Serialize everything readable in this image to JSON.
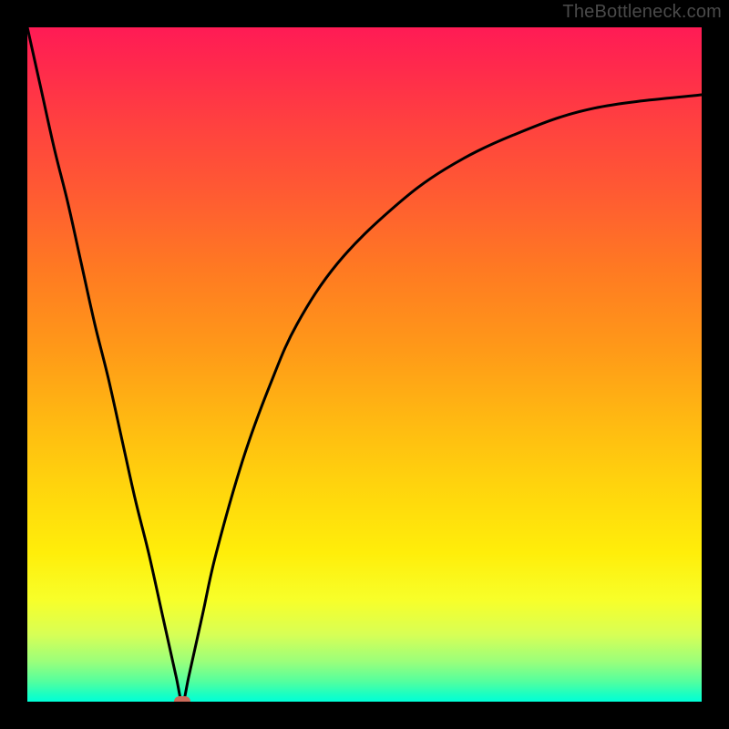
{
  "watermark": "TheBottleneck.com",
  "colors": {
    "frame": "#000000",
    "curve": "#000000",
    "marker": "#cc6a5a"
  },
  "chart_data": {
    "type": "line",
    "title": "",
    "xlabel": "",
    "ylabel": "",
    "x": [
      0,
      2,
      4,
      6,
      8,
      10,
      12,
      14,
      16,
      18,
      20,
      22,
      23,
      24,
      26,
      28,
      32,
      36,
      40,
      46,
      54,
      62,
      72,
      84,
      100
    ],
    "values": [
      100,
      91,
      82,
      74,
      65,
      56,
      48,
      39,
      30,
      22,
      13,
      4,
      0,
      4,
      13,
      22,
      36,
      47,
      56,
      65,
      73,
      79,
      84,
      88,
      90
    ],
    "xlim": [
      0,
      100
    ],
    "ylim": [
      0,
      100
    ],
    "optimum_x": 23,
    "optimum_y": 0
  }
}
